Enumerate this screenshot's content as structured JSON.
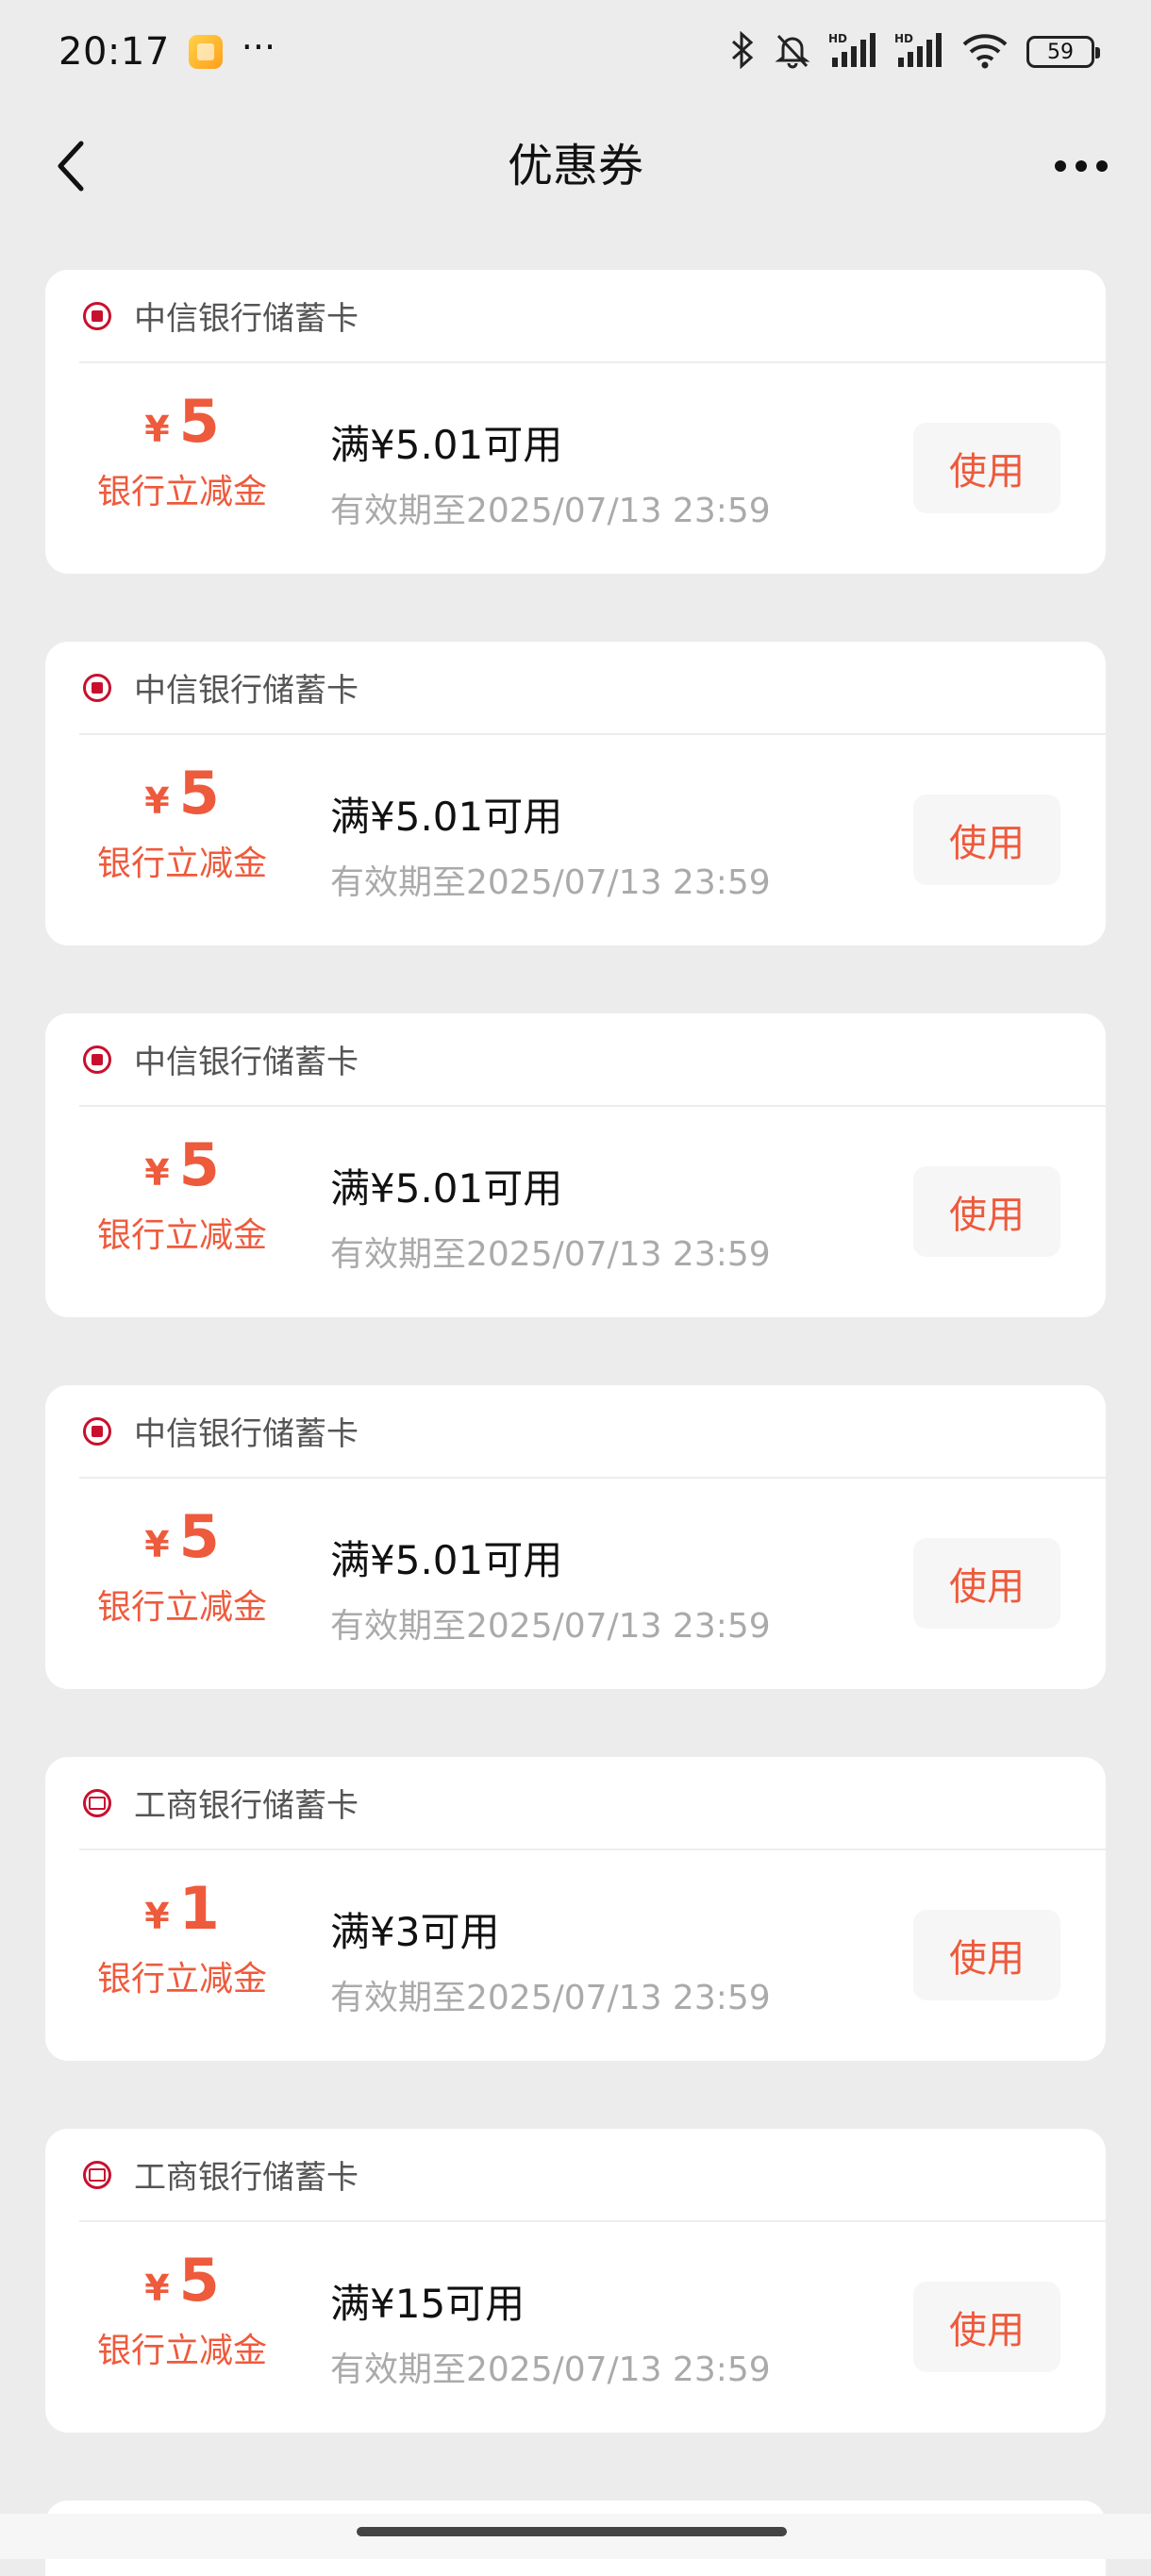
{
  "status_bar": {
    "time": "20:17",
    "more": "···",
    "battery": "59"
  },
  "nav": {
    "title": "优惠券"
  },
  "coupons": [
    {
      "bank": "中信银行储蓄卡",
      "logo": "citic",
      "currency": "¥",
      "amount": "5",
      "label": "银行立减金",
      "condition": "满¥5.01可用",
      "expiry": "有效期至2025/07/13 23:59",
      "button": "使用"
    },
    {
      "bank": "中信银行储蓄卡",
      "logo": "citic",
      "currency": "¥",
      "amount": "5",
      "label": "银行立减金",
      "condition": "满¥5.01可用",
      "expiry": "有效期至2025/07/13 23:59",
      "button": "使用"
    },
    {
      "bank": "中信银行储蓄卡",
      "logo": "citic",
      "currency": "¥",
      "amount": "5",
      "label": "银行立减金",
      "condition": "满¥5.01可用",
      "expiry": "有效期至2025/07/13 23:59",
      "button": "使用"
    },
    {
      "bank": "中信银行储蓄卡",
      "logo": "citic",
      "currency": "¥",
      "amount": "5",
      "label": "银行立减金",
      "condition": "满¥5.01可用",
      "expiry": "有效期至2025/07/13 23:59",
      "button": "使用"
    },
    {
      "bank": "工商银行储蓄卡",
      "logo": "icbc",
      "currency": "¥",
      "amount": "1",
      "label": "银行立减金",
      "condition": "满¥3可用",
      "expiry": "有效期至2025/07/13 23:59",
      "button": "使用"
    },
    {
      "bank": "工商银行储蓄卡",
      "logo": "icbc",
      "currency": "¥",
      "amount": "5",
      "label": "银行立减金",
      "condition": "满¥15可用",
      "expiry": "有效期至2025/07/13 23:59",
      "button": "使用"
    }
  ],
  "colors": {
    "accent": "#ee5a3c",
    "background": "#ececec",
    "bank_logo": "#c8102e"
  },
  "icons": {
    "back": "chevron-left-icon",
    "more": "more-horizontal-icon",
    "bluetooth": "bluetooth-icon",
    "mute": "bell-off-icon",
    "signal": "signal-icon",
    "wifi": "wifi-icon"
  }
}
